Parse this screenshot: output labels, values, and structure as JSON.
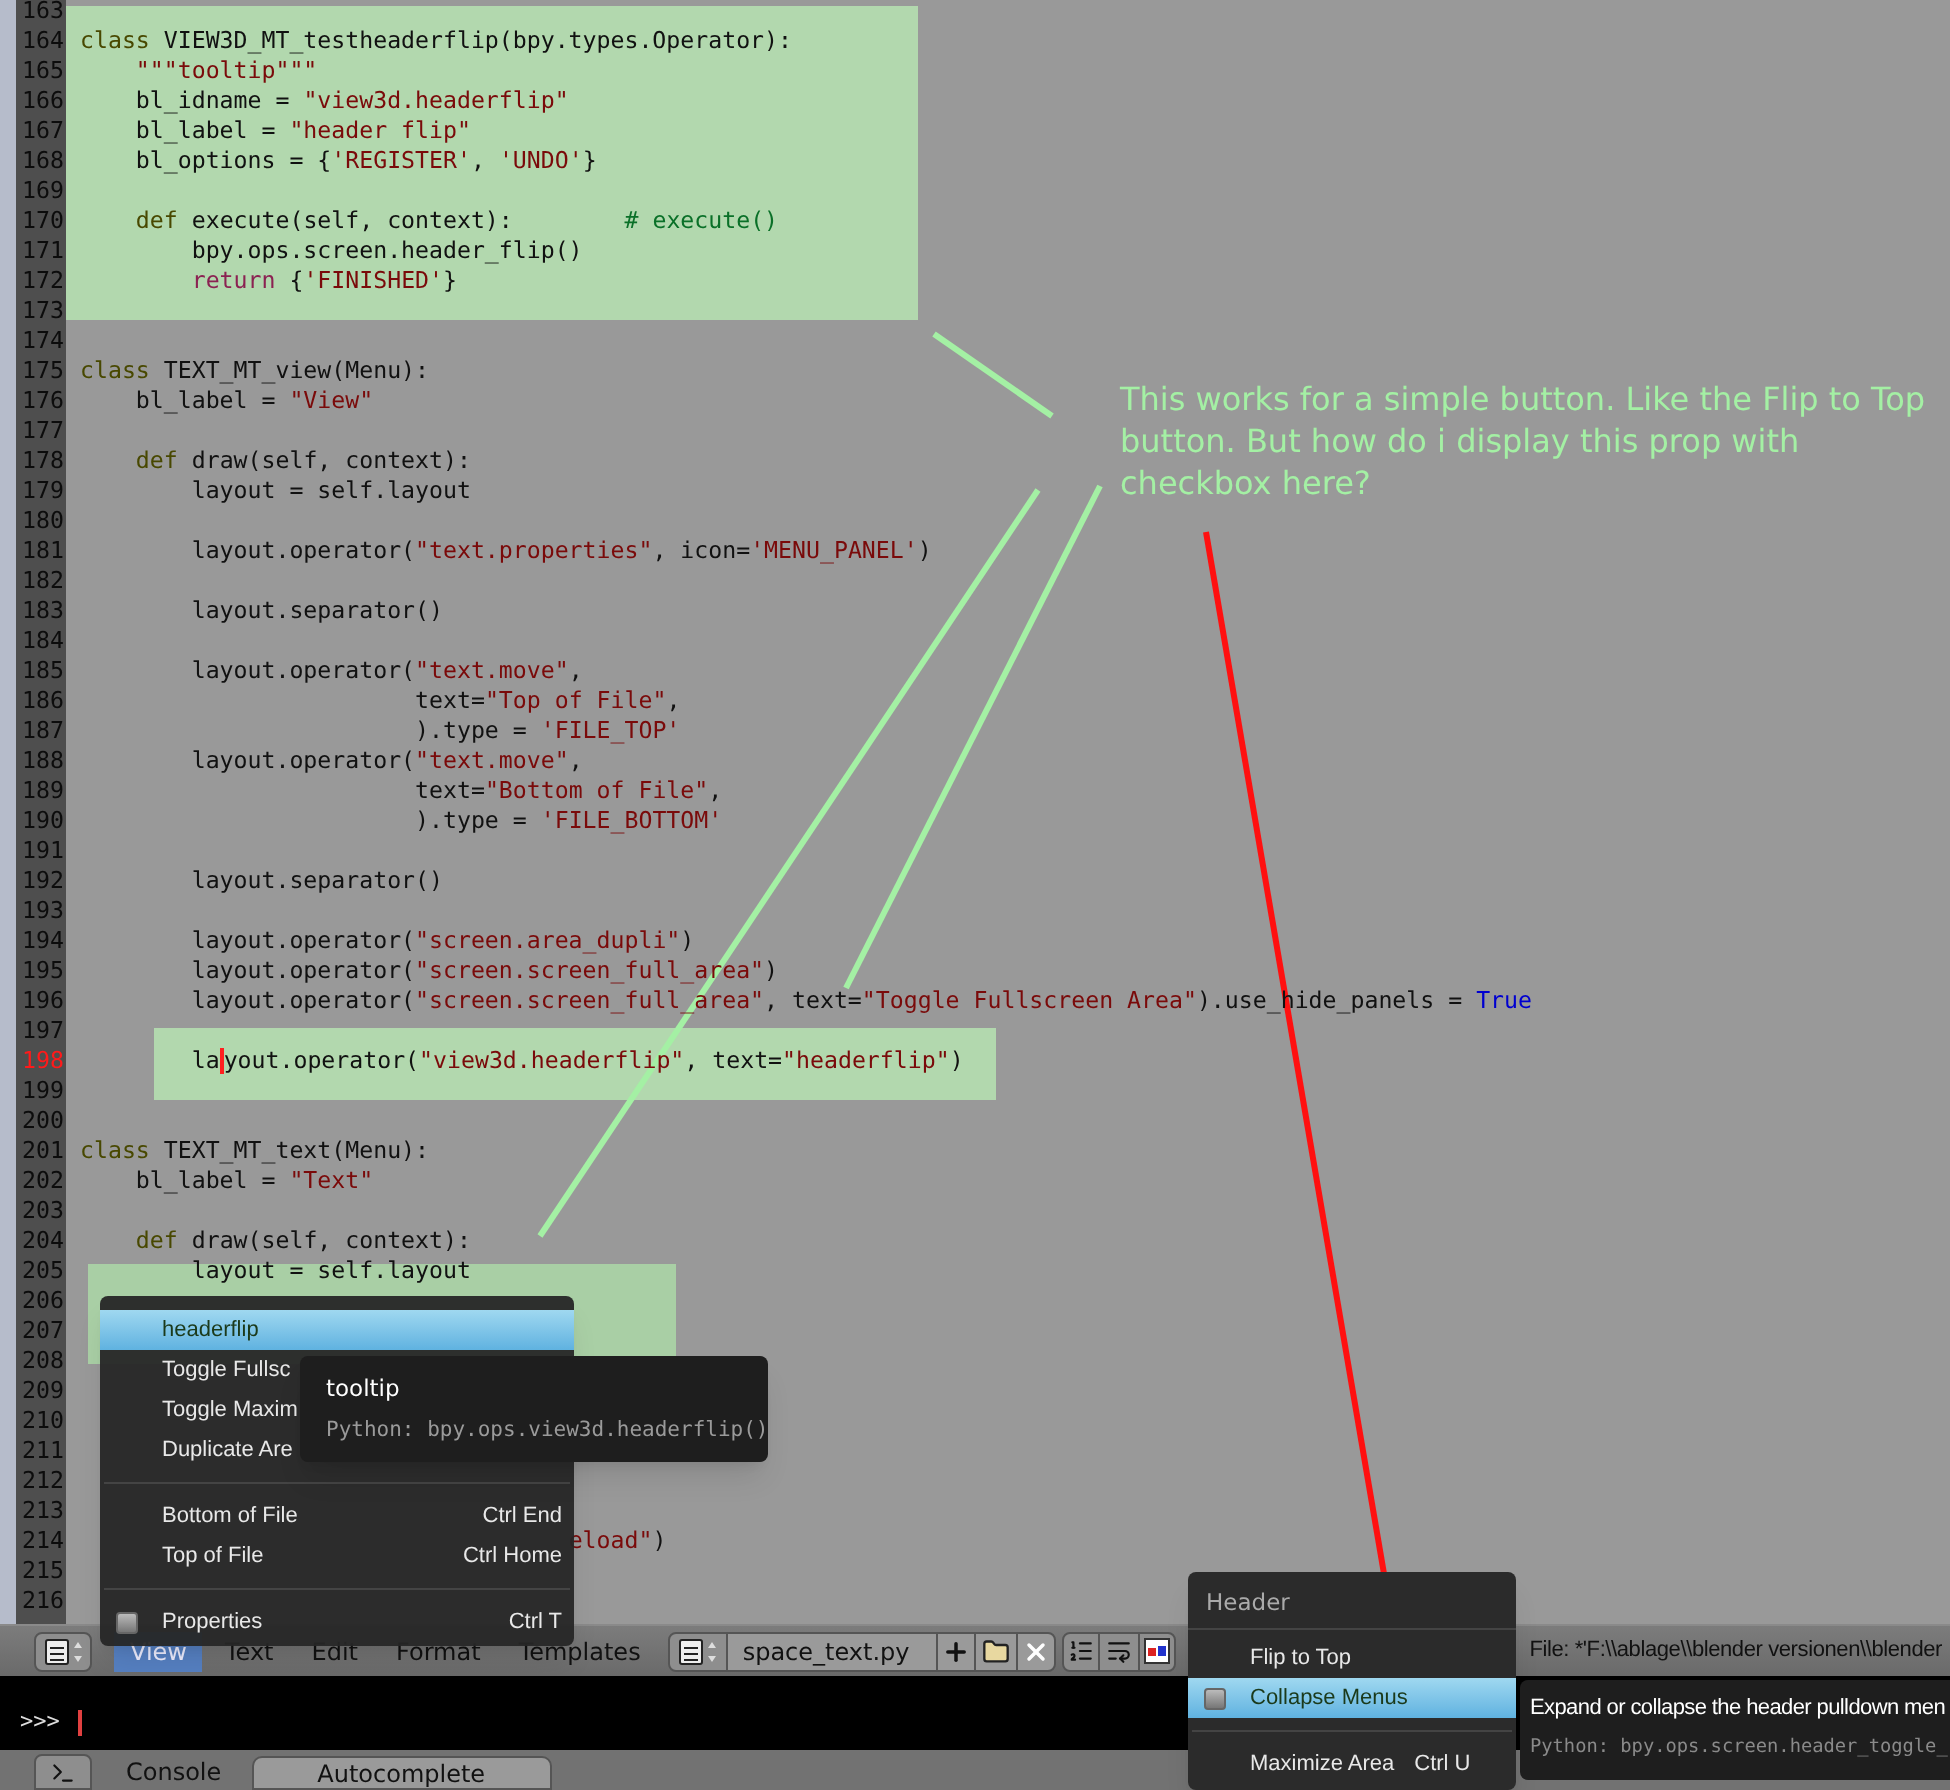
{
  "editor": {
    "lines": [
      {
        "number": "163",
        "current": false
      },
      {
        "number": "164",
        "current": false,
        "tokens": [
          {
            "kind": "keyword",
            "text": "class"
          },
          {
            "kind": "plain",
            "text": " VIEW3D_MT_testheaderflip(bpy.types.Operator):"
          }
        ]
      },
      {
        "number": "165",
        "current": false,
        "tokens": [
          {
            "kind": "string",
            "text": "    \"\"\"tooltip\"\"\""
          }
        ]
      },
      {
        "number": "166",
        "current": false,
        "tokens": [
          {
            "kind": "plain",
            "text": "    bl_idname = "
          },
          {
            "kind": "string",
            "text": "\"view3d.headerflip\""
          }
        ]
      },
      {
        "number": "167",
        "current": false,
        "tokens": [
          {
            "kind": "plain",
            "text": "    bl_label = "
          },
          {
            "kind": "string",
            "text": "\"header flip\""
          }
        ]
      },
      {
        "number": "168",
        "current": false,
        "tokens": [
          {
            "kind": "plain",
            "text": "    bl_options = {"
          },
          {
            "kind": "string",
            "text": "'REGISTER'"
          },
          {
            "kind": "plain",
            "text": ", "
          },
          {
            "kind": "string",
            "text": "'UNDO'"
          },
          {
            "kind": "plain",
            "text": "}"
          }
        ]
      },
      {
        "number": "169",
        "current": false
      },
      {
        "number": "170",
        "current": false,
        "tokens": [
          {
            "kind": "keyword",
            "text": "    def"
          },
          {
            "kind": "plain",
            "text": " execute(self, context):        "
          },
          {
            "kind": "comment",
            "text": "# execute()"
          }
        ]
      },
      {
        "number": "171",
        "current": false,
        "tokens": [
          {
            "kind": "plain",
            "text": "        bpy.ops.screen.header_flip()"
          }
        ]
      },
      {
        "number": "172",
        "current": false,
        "tokens": [
          {
            "kind": "keyword2",
            "text": "        return"
          },
          {
            "kind": "plain",
            "text": " {"
          },
          {
            "kind": "string",
            "text": "'FINISHED'"
          },
          {
            "kind": "plain",
            "text": "}"
          }
        ]
      },
      {
        "number": "173",
        "current": false
      },
      {
        "number": "174",
        "current": false
      },
      {
        "number": "175",
        "current": false,
        "tokens": [
          {
            "kind": "keyword",
            "text": "class"
          },
          {
            "kind": "plain",
            "text": " TEXT_MT_view(Menu):"
          }
        ]
      },
      {
        "number": "176",
        "current": false,
        "tokens": [
          {
            "kind": "plain",
            "text": "    bl_label = "
          },
          {
            "kind": "string",
            "text": "\"View\""
          }
        ]
      },
      {
        "number": "177",
        "current": false
      },
      {
        "number": "178",
        "current": false,
        "tokens": [
          {
            "kind": "keyword",
            "text": "    def"
          },
          {
            "kind": "plain",
            "text": " draw(self, context):"
          }
        ]
      },
      {
        "number": "179",
        "current": false,
        "tokens": [
          {
            "kind": "plain",
            "text": "        layout = self.layout"
          }
        ]
      },
      {
        "number": "180",
        "current": false
      },
      {
        "number": "181",
        "current": false,
        "tokens": [
          {
            "kind": "plain",
            "text": "        layout.operator("
          },
          {
            "kind": "string",
            "text": "\"text.properties\""
          },
          {
            "kind": "plain",
            "text": ", icon="
          },
          {
            "kind": "string",
            "text": "'MENU_PANEL'"
          },
          {
            "kind": "plain",
            "text": ")"
          }
        ]
      },
      {
        "number": "182",
        "current": false
      },
      {
        "number": "183",
        "current": false,
        "tokens": [
          {
            "kind": "plain",
            "text": "        layout.separator()"
          }
        ]
      },
      {
        "number": "184",
        "current": false
      },
      {
        "number": "185",
        "current": false,
        "tokens": [
          {
            "kind": "plain",
            "text": "        layout.operator("
          },
          {
            "kind": "string",
            "text": "\"text.move\""
          },
          {
            "kind": "plain",
            "text": ","
          }
        ]
      },
      {
        "number": "186",
        "current": false,
        "tokens": [
          {
            "kind": "plain",
            "text": "                        text="
          },
          {
            "kind": "string",
            "text": "\"Top of File\""
          },
          {
            "kind": "plain",
            "text": ","
          }
        ]
      },
      {
        "number": "187",
        "current": false,
        "tokens": [
          {
            "kind": "plain",
            "text": "                        ).type = "
          },
          {
            "kind": "string",
            "text": "'FILE_TOP'"
          }
        ]
      },
      {
        "number": "188",
        "current": false,
        "tokens": [
          {
            "kind": "plain",
            "text": "        layout.operator("
          },
          {
            "kind": "string",
            "text": "\"text.move\""
          },
          {
            "kind": "plain",
            "text": ","
          }
        ]
      },
      {
        "number": "189",
        "current": false,
        "tokens": [
          {
            "kind": "plain",
            "text": "                        text="
          },
          {
            "kind": "string",
            "text": "\"Bottom of File\""
          },
          {
            "kind": "plain",
            "text": ","
          }
        ]
      },
      {
        "number": "190",
        "current": false,
        "tokens": [
          {
            "kind": "plain",
            "text": "                        ).type = "
          },
          {
            "kind": "string",
            "text": "'FILE_BOTTOM'"
          }
        ]
      },
      {
        "number": "191",
        "current": false
      },
      {
        "number": "192",
        "current": false,
        "tokens": [
          {
            "kind": "plain",
            "text": "        layout.separator()"
          }
        ]
      },
      {
        "number": "193",
        "current": false
      },
      {
        "number": "194",
        "current": false,
        "tokens": [
          {
            "kind": "plain",
            "text": "        layout.operator("
          },
          {
            "kind": "string",
            "text": "\"screen.area_dupli\""
          },
          {
            "kind": "plain",
            "text": ")"
          }
        ]
      },
      {
        "number": "195",
        "current": false,
        "tokens": [
          {
            "kind": "plain",
            "text": "        layout.operator("
          },
          {
            "kind": "string",
            "text": "\"screen.screen_full_area\""
          },
          {
            "kind": "plain",
            "text": ")"
          }
        ]
      },
      {
        "number": "196",
        "current": false,
        "tokens": [
          {
            "kind": "plain",
            "text": "        layout.operator("
          },
          {
            "kind": "string",
            "text": "\"screen.screen_full_area\""
          },
          {
            "kind": "plain",
            "text": ", text="
          },
          {
            "kind": "string",
            "text": "\"Toggle Fullscreen Area\""
          },
          {
            "kind": "plain",
            "text": ").use_hide_panels = "
          },
          {
            "kind": "builtin",
            "text": "True"
          }
        ]
      },
      {
        "number": "197",
        "current": false
      },
      {
        "number": "198",
        "current": true,
        "tokens": [
          {
            "kind": "plain",
            "text": "        la"
          },
          {
            "kind": "cursor"
          },
          {
            "kind": "plain",
            "text": "yout.operator("
          },
          {
            "kind": "string",
            "text": "\"view3d.headerflip\""
          },
          {
            "kind": "plain",
            "text": ", text="
          },
          {
            "kind": "string",
            "text": "\"headerflip\""
          },
          {
            "kind": "plain",
            "text": ")"
          }
        ]
      },
      {
        "number": "199",
        "current": false
      },
      {
        "number": "200",
        "current": false
      },
      {
        "number": "201",
        "current": false,
        "tokens": [
          {
            "kind": "keyword",
            "text": "class"
          },
          {
            "kind": "plain",
            "text": " TEXT_MT_text(Menu):"
          }
        ]
      },
      {
        "number": "202",
        "current": false,
        "tokens": [
          {
            "kind": "plain",
            "text": "    bl_label = "
          },
          {
            "kind": "string",
            "text": "\"Text\""
          }
        ]
      },
      {
        "number": "203",
        "current": false
      },
      {
        "number": "204",
        "current": false,
        "tokens": [
          {
            "kind": "keyword",
            "text": "    def"
          },
          {
            "kind": "plain",
            "text": " draw(self, context):"
          }
        ]
      },
      {
        "number": "205",
        "current": false,
        "tokens": [
          {
            "kind": "plain",
            "text": "        layout = self.layout"
          }
        ]
      },
      {
        "number": "206",
        "current": false
      },
      {
        "number": "207",
        "current": false
      },
      {
        "number": "208",
        "current": false
      },
      {
        "number": "209",
        "current": false
      },
      {
        "number": "210",
        "current": false
      },
      {
        "number": "211",
        "current": false
      },
      {
        "number": "212",
        "current": false
      },
      {
        "number": "213",
        "current": false
      },
      {
        "number": "214",
        "current": false,
        "tokens": [
          {
            "kind": "string",
            "text": "                                   eload\""
          },
          {
            "kind": "plain",
            "text": ")"
          }
        ]
      },
      {
        "number": "215",
        "current": false
      },
      {
        "number": "216",
        "current": false
      }
    ]
  },
  "view_menu": {
    "items": [
      {
        "kind": "item",
        "label": "headerflip",
        "selected": true
      },
      {
        "kind": "item",
        "label": "Toggle Fullsc",
        "selected": false
      },
      {
        "kind": "item",
        "label": "Toggle Maxim",
        "selected": false
      },
      {
        "kind": "item",
        "label": "Duplicate Are",
        "selected": false
      },
      {
        "kind": "separator"
      },
      {
        "kind": "item",
        "label": "Bottom of File",
        "shortcut": "Ctrl End",
        "selected": false
      },
      {
        "kind": "item",
        "label": "Top of File",
        "shortcut": "Ctrl Home",
        "selected": false
      },
      {
        "kind": "separator"
      },
      {
        "kind": "checkbox",
        "label": "Properties",
        "shortcut": "Ctrl T",
        "checked": false,
        "selected": false
      }
    ]
  },
  "view_tooltip": {
    "title": "tooltip",
    "python": "Python: bpy.ops.view3d.headerflip()"
  },
  "header_bar": {
    "menus": [
      {
        "label": "View",
        "selected": true
      },
      {
        "label": "Text",
        "selected": false
      },
      {
        "label": "Edit",
        "selected": false
      },
      {
        "label": "Format",
        "selected": false
      },
      {
        "label": "Templates",
        "selected": false
      }
    ],
    "filename": "space_text.py",
    "file_path": "File: *'F:\\\\ablage\\\\blender versionen\\\\blender"
  },
  "header_menu": {
    "title": "Header",
    "items": [
      {
        "kind": "item",
        "label": "Flip to Top",
        "selected": false
      },
      {
        "kind": "checkbox",
        "label": "Collapse Menus",
        "checked": false,
        "selected": true
      },
      {
        "kind": "separator"
      },
      {
        "kind": "item",
        "label": "Maximize Area",
        "shortcut": "Ctrl U",
        "selected": false
      }
    ]
  },
  "header_tooltip": {
    "title": "Expand or collapse the header pulldown men",
    "python": "Python: bpy.ops.screen.header_toggle_"
  },
  "console": {
    "prompt": ">>>",
    "tabs": [
      {
        "label": "Console",
        "selected": false
      },
      {
        "label": "Autocomplete",
        "selected": true
      }
    ]
  },
  "annotation": {
    "text": "This works for a simple button. Like the Flip to Top button. But how do i display this prop with checkbox here?"
  }
}
